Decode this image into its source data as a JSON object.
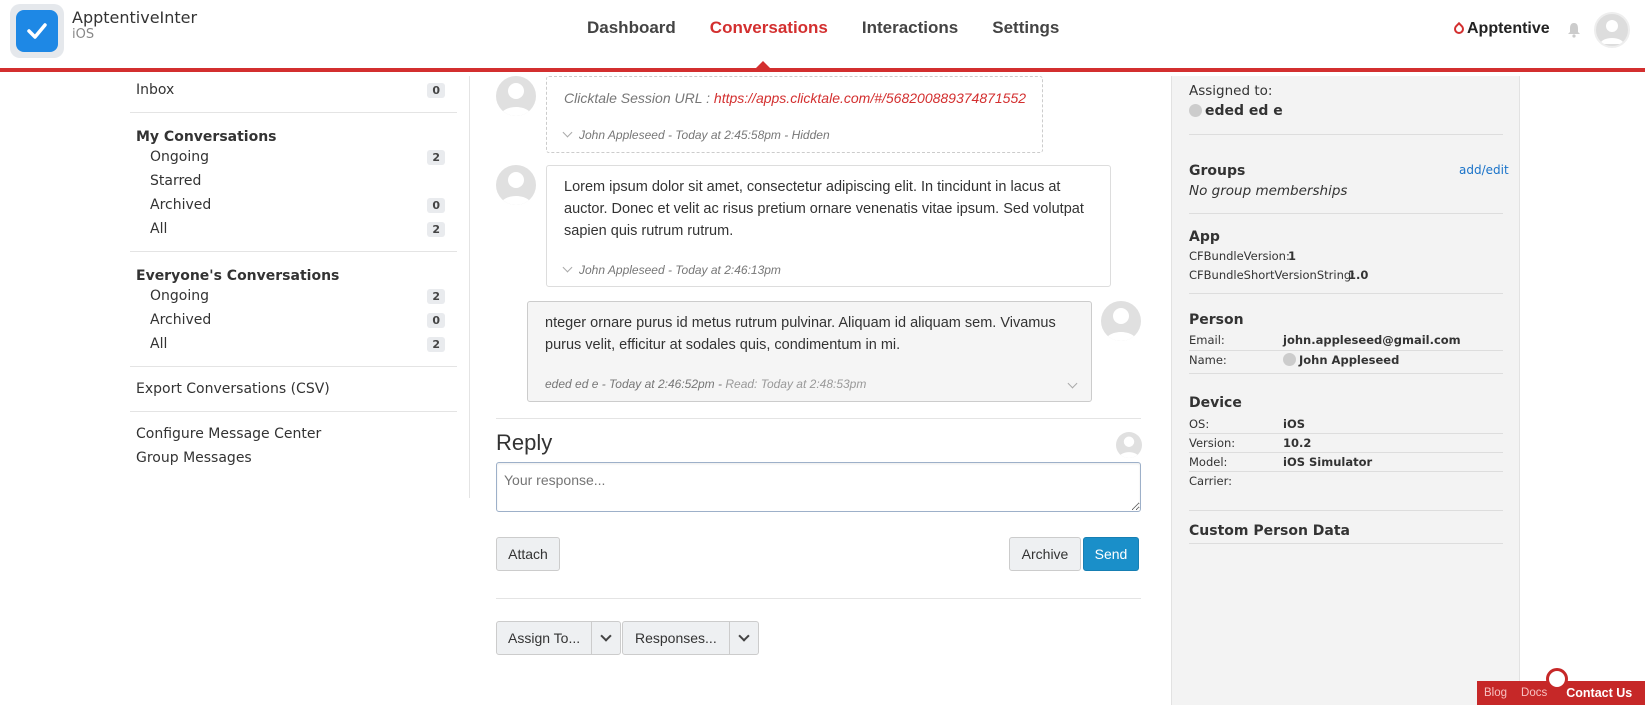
{
  "header": {
    "app_name": "ApptentiveInter",
    "app_platform": "iOS",
    "nav": [
      "Dashboard",
      "Conversations",
      "Interactions",
      "Settings"
    ],
    "active_nav": "Conversations",
    "brand": "Apptentive",
    "accent_color": "#d32f2f"
  },
  "sidebar": {
    "inbox": {
      "label": "Inbox",
      "count": "0"
    },
    "my_conversations": {
      "heading": "My Conversations",
      "items": [
        {
          "label": "Ongoing",
          "count": "2"
        },
        {
          "label": "Starred",
          "count": ""
        },
        {
          "label": "Archived",
          "count": "0"
        },
        {
          "label": "All",
          "count": "2"
        }
      ]
    },
    "everyone_conversations": {
      "heading": "Everyone's Conversations",
      "items": [
        {
          "label": "Ongoing",
          "count": "2"
        },
        {
          "label": "Archived",
          "count": "0"
        },
        {
          "label": "All",
          "count": "2"
        }
      ]
    },
    "export": "Export Conversations (CSV)",
    "configure": "Configure Message Center",
    "group_messages": "Group Messages"
  },
  "messages": [
    {
      "label": "Clicktale Session URL : ",
      "url": "https://apps.clicktale.com/#/568200889374871552",
      "meta": "John Appleseed - Today at 2:45:58pm - Hidden"
    },
    {
      "text": "Lorem ipsum dolor sit amet, consectetur adipiscing elit. In tincidunt in lacus at auctor. Donec et velit ac risus pretium ornare venenatis vitae ipsum. Sed volutpat sapien quis rutrum rutrum.",
      "meta": "John Appleseed - Today at 2:46:13pm"
    },
    {
      "text": "nteger ornare purus id metus rutrum pulvinar. Aliquam id aliquam sem. Vivamus purus velit, efficitur at sodales quis, condimentum in mi.",
      "meta": "eded ed e - Today at 2:46:52pm - ",
      "read": "Read: Today at 2:48:53pm"
    }
  ],
  "reply": {
    "title": "Reply",
    "placeholder": "Your response...",
    "attach": "Attach",
    "archive": "Archive",
    "send": "Send",
    "assign": "Assign To...",
    "responses": "Responses..."
  },
  "details": {
    "assigned_label": "Assigned to:",
    "assigned_name": "eded ed e",
    "groups_heading": "Groups",
    "groups_action": "add/edit",
    "groups_value": "No group memberships",
    "app_heading": "App",
    "app_rows": [
      {
        "key": "CFBundleVersion:",
        "value": "1"
      },
      {
        "key": "CFBundleShortVersionString:",
        "value": "1.0"
      }
    ],
    "person_heading": "Person",
    "email_key": "Email:",
    "email_value": "john.appleseed@gmail.com",
    "name_key": "Name:",
    "name_value": "John Appleseed",
    "device_heading": "Device",
    "device_rows": [
      {
        "key": "OS:",
        "value": "iOS"
      },
      {
        "key": "Version:",
        "value": "10.2"
      },
      {
        "key": "Model:",
        "value": "iOS Simulator"
      },
      {
        "key": "Carrier:",
        "value": ""
      }
    ],
    "custom_heading": "Custom Person Data"
  },
  "footer": {
    "blog": "Blog",
    "docs": "Docs",
    "contact": "Contact Us"
  }
}
